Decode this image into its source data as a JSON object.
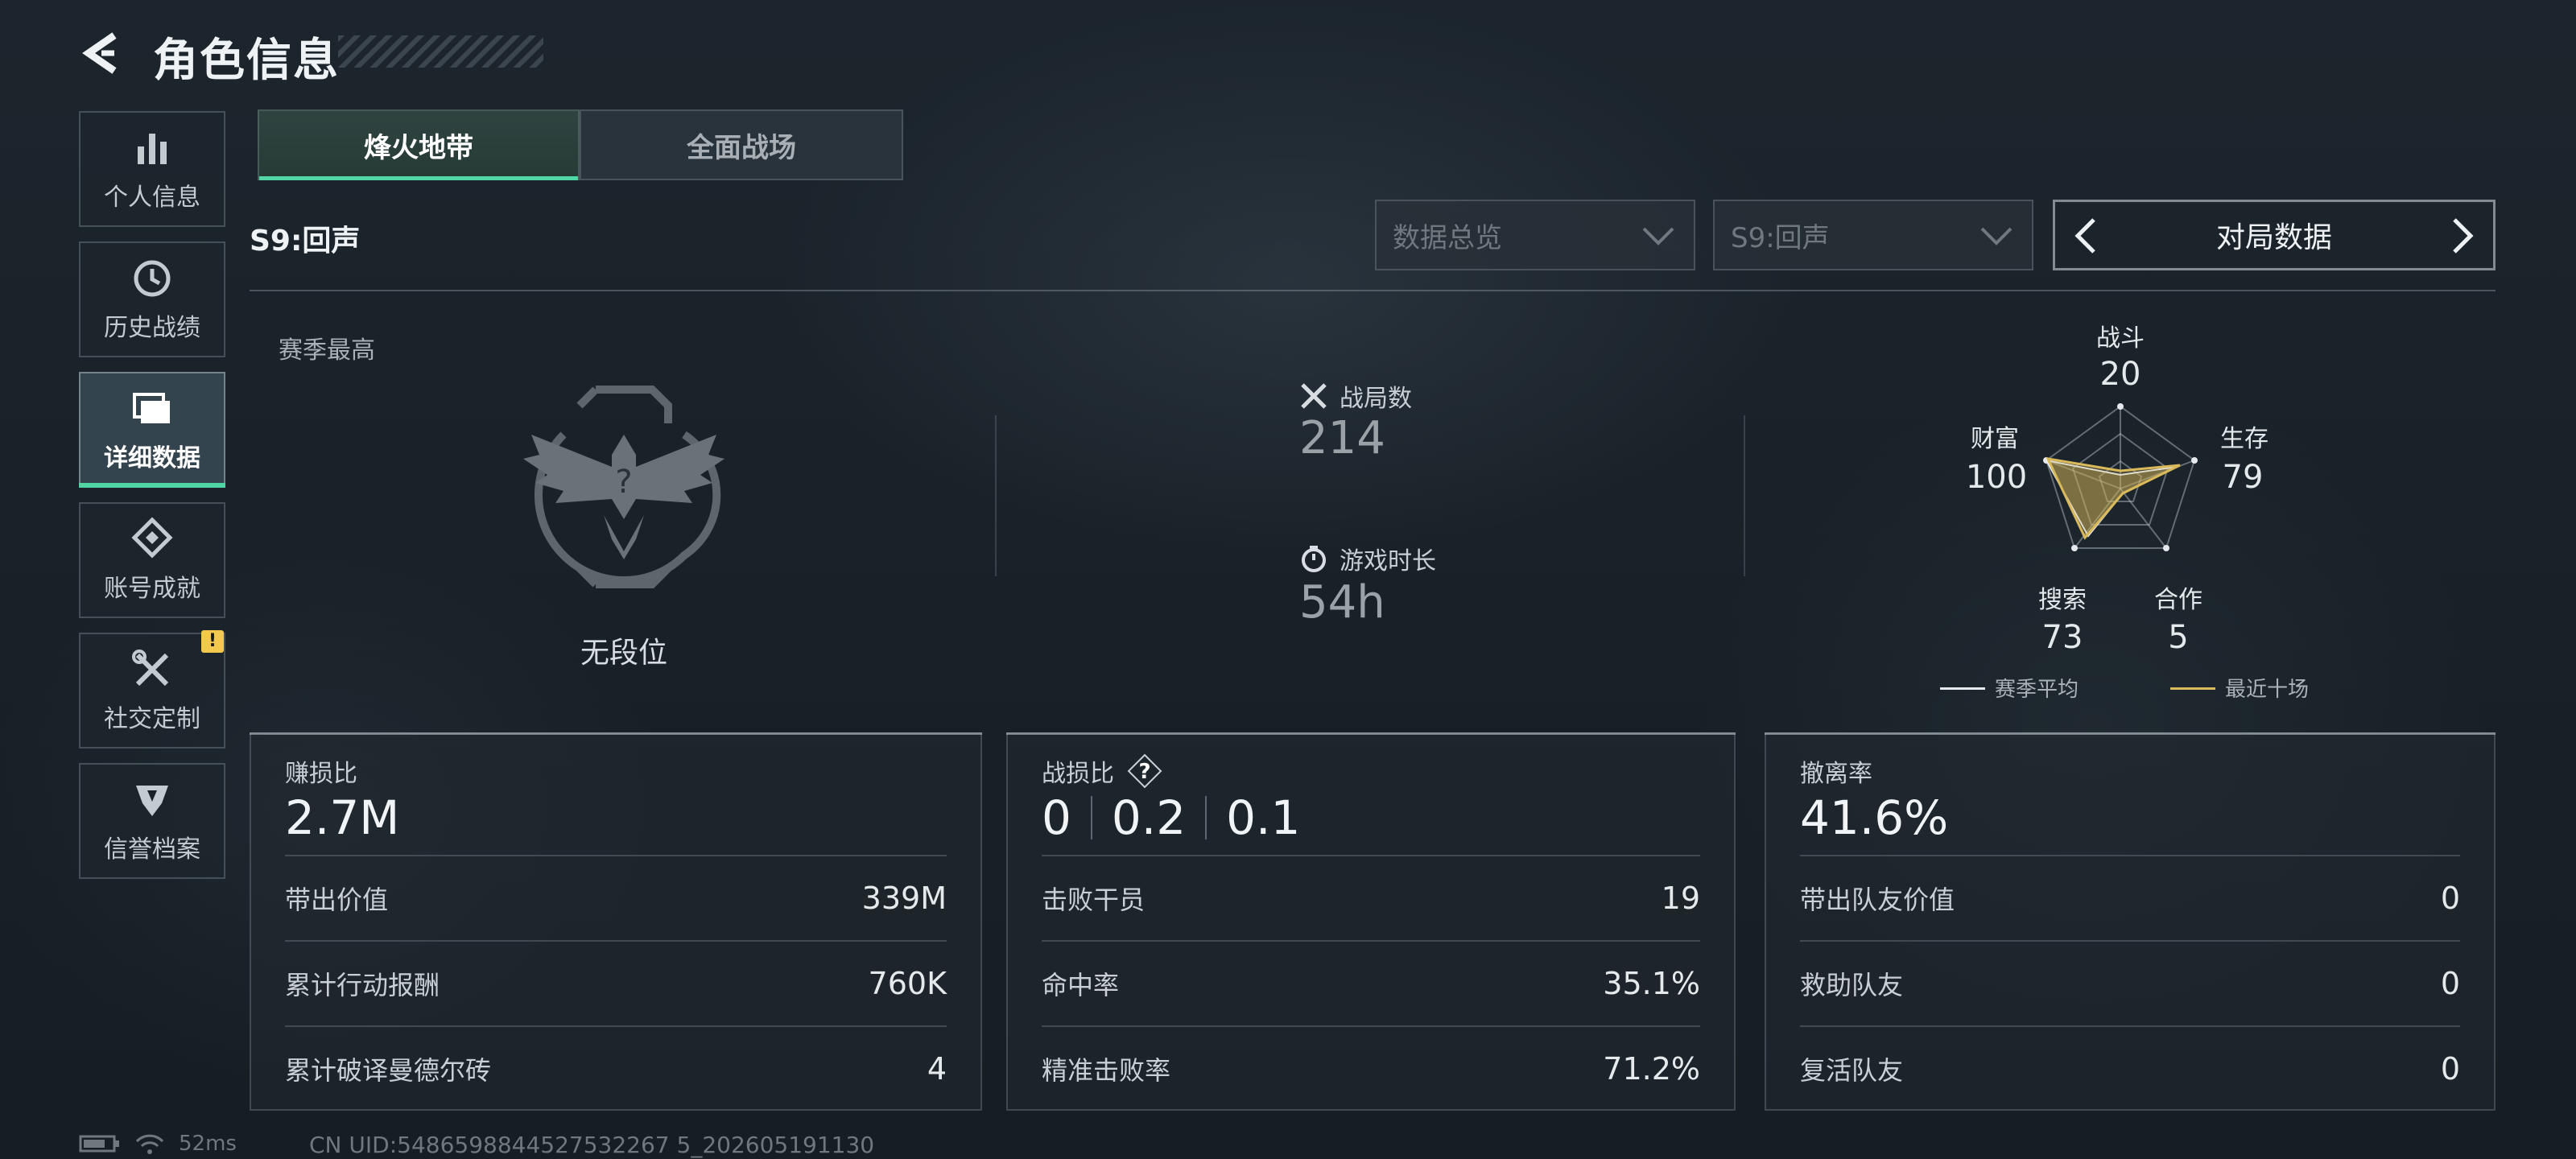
{
  "header": {
    "title": "角色信息"
  },
  "sidebar": {
    "items": [
      {
        "label": "个人信息",
        "icon": "bar-chart-icon"
      },
      {
        "label": "历史战绩",
        "icon": "clock-history-icon"
      },
      {
        "label": "详细数据",
        "icon": "folders-icon",
        "active": true
      },
      {
        "label": "账号成就",
        "icon": "medal-icon"
      },
      {
        "label": "社交定制",
        "icon": "tools-icon",
        "badge": "!"
      },
      {
        "label": "信誉档案",
        "icon": "shield-icon"
      }
    ]
  },
  "tabs": [
    {
      "label": "烽火地带",
      "active": true
    },
    {
      "label": "全面战场",
      "active": false
    }
  ],
  "season_label": "S9:回声",
  "filters": {
    "dropdown1": "数据总览",
    "dropdown2": "S9:回声",
    "match_nav": "对局数据"
  },
  "overview": {
    "season_best_label": "赛季最高",
    "rank_name": "无段位",
    "battles": {
      "label": "战局数",
      "value": "214"
    },
    "play_time": {
      "label": "游戏时长",
      "value": "54h"
    }
  },
  "radar": {
    "axes": [
      {
        "label": "战斗",
        "value": "20"
      },
      {
        "label": "生存",
        "value": "79"
      },
      {
        "label": "合作",
        "value": "5"
      },
      {
        "label": "搜索",
        "value": "73"
      },
      {
        "label": "财富",
        "value": "100"
      }
    ],
    "legend": {
      "season_avg": "赛季平均",
      "recent10": "最近十场"
    },
    "colors": {
      "season_avg": "#e6eaee",
      "recent10": "#d9b95a"
    }
  },
  "cards": {
    "profit": {
      "title": "赚损比",
      "main": "2.7M",
      "rows": [
        {
          "label": "带出价值",
          "value": "339M"
        },
        {
          "label": "累计行动报酬",
          "value": "760K"
        },
        {
          "label": "累计破译曼德尔砖",
          "value": "4"
        }
      ]
    },
    "combat": {
      "title": "战损比",
      "main_values": [
        "0",
        "0.2",
        "0.1"
      ],
      "rows": [
        {
          "label": "击败干员",
          "value": "19"
        },
        {
          "label": "命中率",
          "value": "35.1%"
        },
        {
          "label": "精准击败率",
          "value": "71.2%"
        }
      ]
    },
    "extract": {
      "title": "撤离率",
      "main": "41.6%",
      "rows": [
        {
          "label": "带出队友价值",
          "value": "0"
        },
        {
          "label": "救助队友",
          "value": "0"
        },
        {
          "label": "复活队友",
          "value": "0"
        }
      ]
    }
  },
  "footer": {
    "ping": "52ms",
    "uid": "CN UID:5486598844527532267 5_202605191130"
  },
  "accent_color": "#4fd6a4"
}
